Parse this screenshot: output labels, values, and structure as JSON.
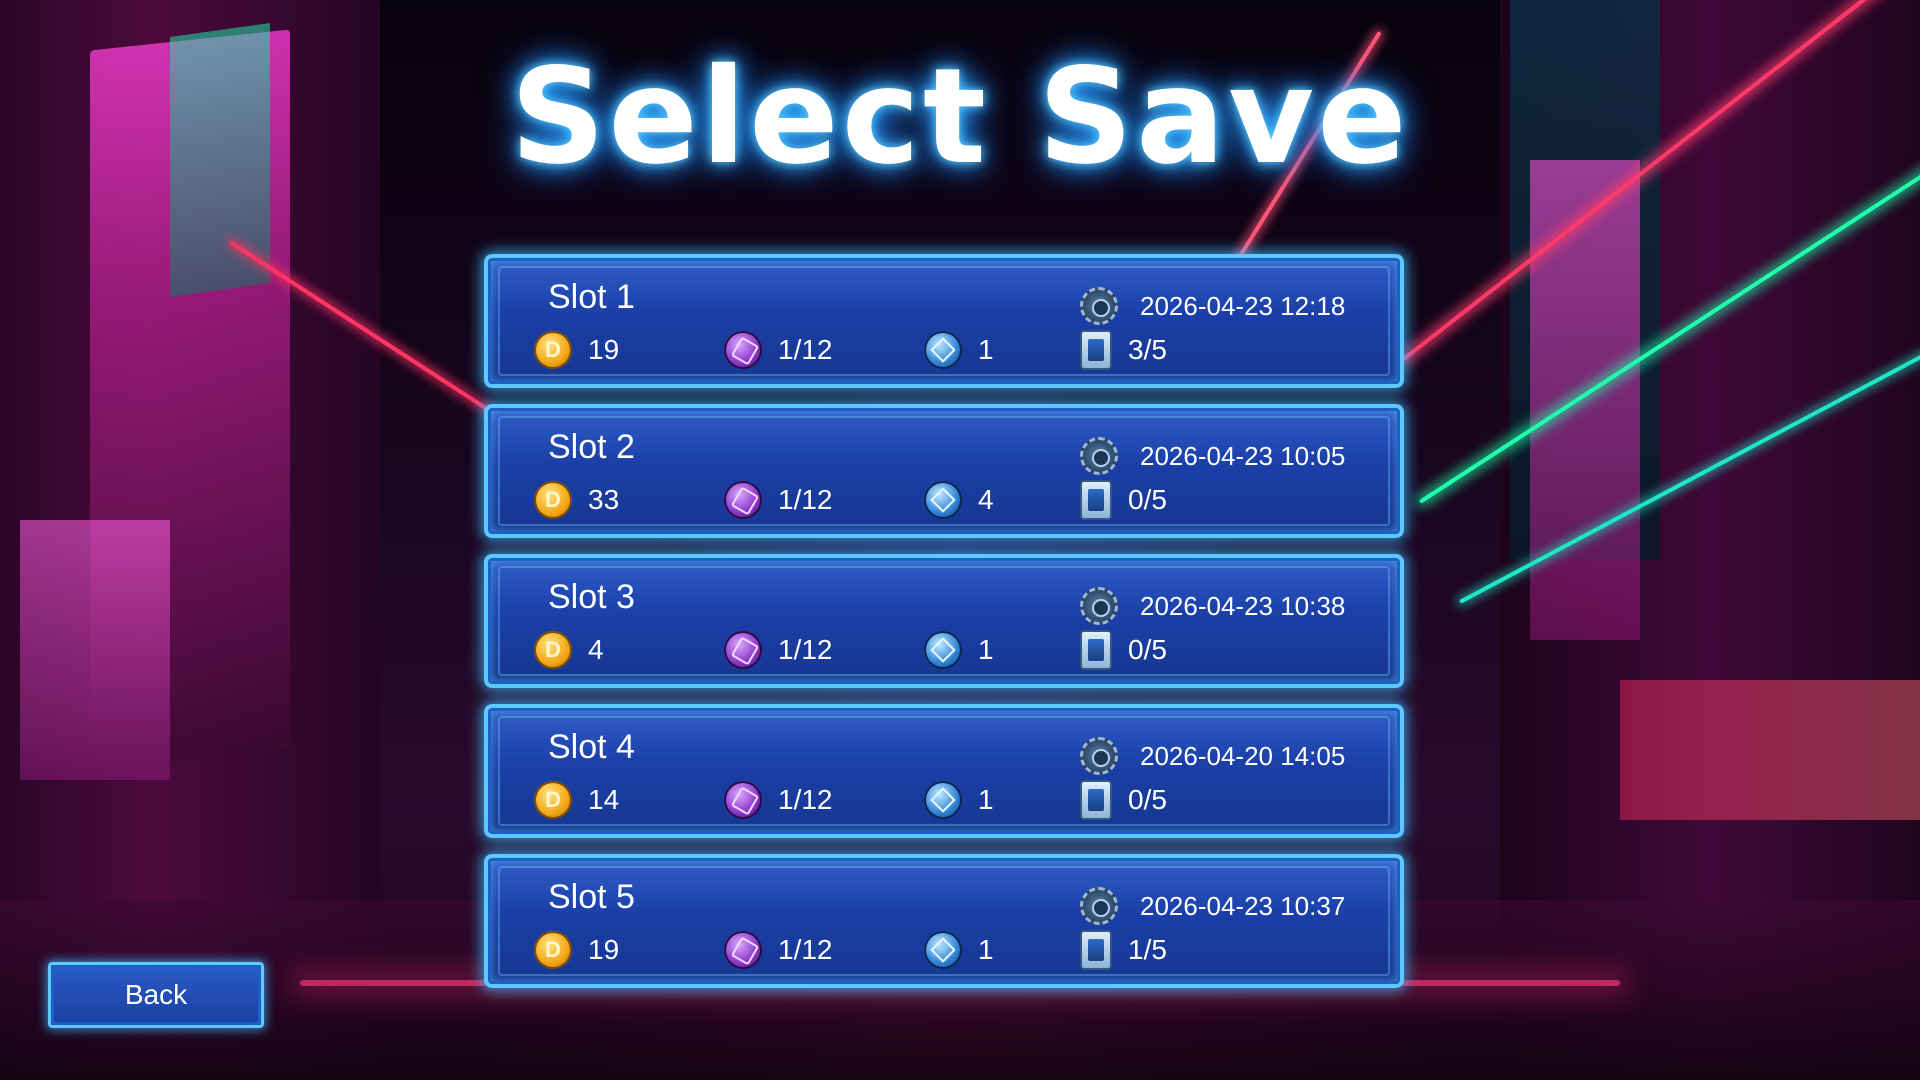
{
  "screen": {
    "title": "Select Save",
    "accent_color": "#5ec8ff",
    "panel_color": "#1b3fa8"
  },
  "icons": {
    "coins": "coin-icon",
    "gems": "purple-gem-icon",
    "orbs": "blue-orb-icon",
    "date": "gear-clock-icon",
    "cards": "card-icon"
  },
  "slots": [
    {
      "name": "Slot 1",
      "date": "2026-04-23 12:18",
      "coins": "19",
      "gems": "1/12",
      "orbs": "1",
      "cards": "3/5"
    },
    {
      "name": "Slot 2",
      "date": "2026-04-23 10:05",
      "coins": "33",
      "gems": "1/12",
      "orbs": "4",
      "cards": "0/5"
    },
    {
      "name": "Slot 3",
      "date": "2026-04-23 10:38",
      "coins": "4",
      "gems": "1/12",
      "orbs": "1",
      "cards": "0/5"
    },
    {
      "name": "Slot 4",
      "date": "2026-04-20 14:05",
      "coins": "14",
      "gems": "1/12",
      "orbs": "1",
      "cards": "0/5"
    },
    {
      "name": "Slot 5",
      "date": "2026-04-23 10:37",
      "coins": "19",
      "gems": "1/12",
      "orbs": "1",
      "cards": "1/5"
    }
  ],
  "back_label": "Back"
}
